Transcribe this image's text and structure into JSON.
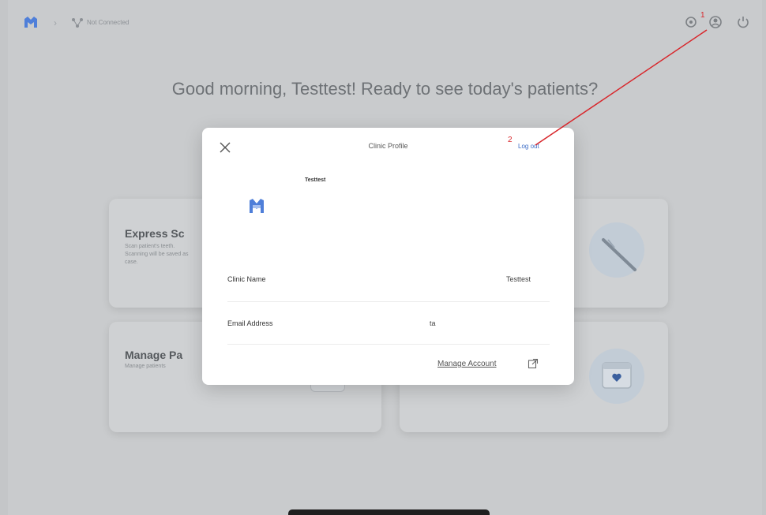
{
  "topbar": {
    "connection_label": "Not Connected",
    "icons": [
      "home-logo-icon",
      "connection-icon",
      "settings-icon",
      "account-icon",
      "power-icon"
    ]
  },
  "greeting": "Good morning, Testtest! Ready to see today's patients?",
  "cards": {
    "express_scan": {
      "title": "Express Sc",
      "description": "Scan patient's teeth. Scanning will be saved as case."
    },
    "manage_patients": {
      "title": "Manage Pa",
      "description": "Manage patients"
    }
  },
  "dialog": {
    "title": "Clinic Profile",
    "logout_label": "Log out",
    "clinic_name_header": "Testtest",
    "rows": [
      {
        "label": "Clinic Name",
        "value": "Testtest"
      },
      {
        "label": "Email Address",
        "value": "ta"
      }
    ],
    "manage_account_label": "Manage Account"
  },
  "annotations": {
    "step1": "1",
    "step2": "2",
    "color": "#d8262b"
  },
  "colors": {
    "accent": "#3b6cc6",
    "brand_logo": "#4f7fd9"
  }
}
